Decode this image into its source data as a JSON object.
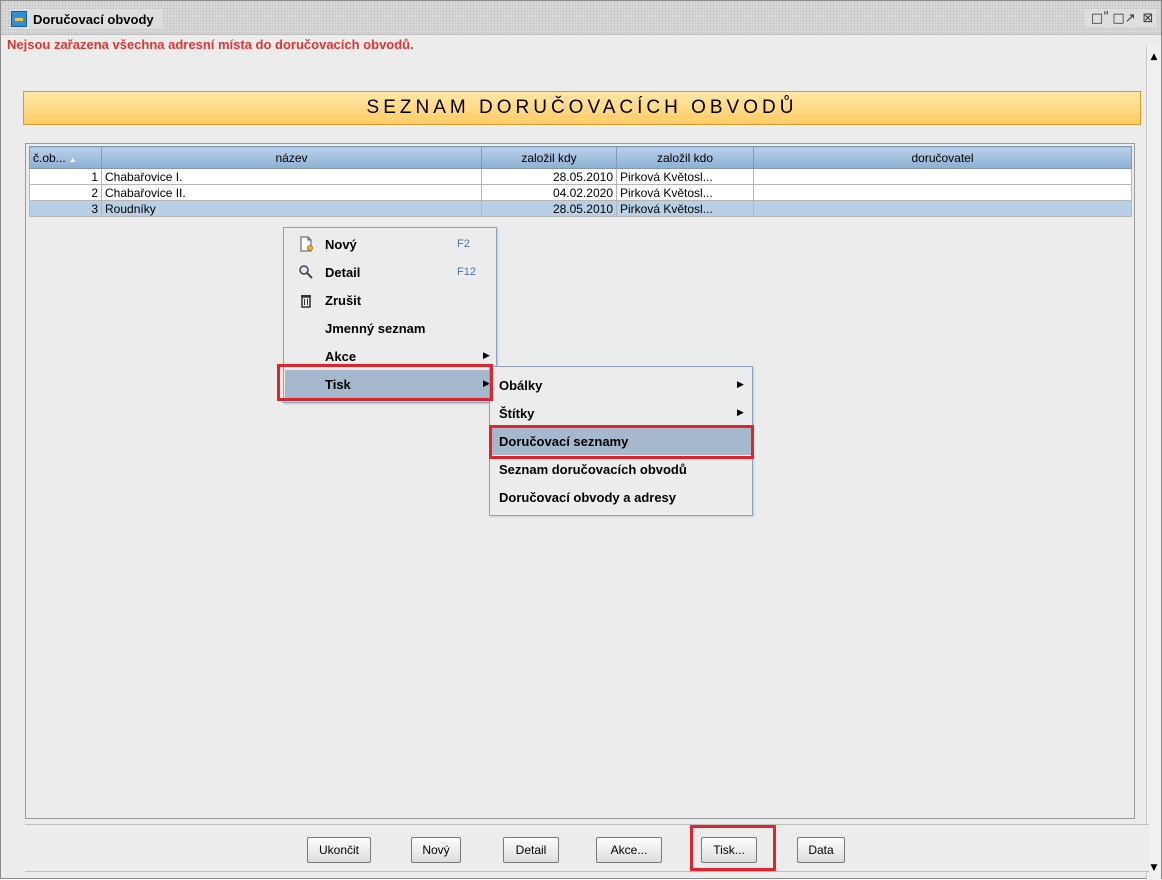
{
  "window": {
    "title": "Doručovací obvody",
    "controls": {
      "minimize_icon": "□ʺ",
      "maximize_icon": "□↗",
      "close_icon": "⊠"
    }
  },
  "warning": "Nejsou zařazena všechna adresní místa do doručovacích obvodů.",
  "banner": "SEZNAM DORUČOVACÍCH OBVODŮ",
  "table": {
    "columns": [
      "č.ob...",
      "název",
      "založil kdy",
      "založil kdo",
      "doručovatel"
    ],
    "rows": [
      {
        "cislo": "1",
        "nazev": "Chabařovice I.",
        "kdy": "28.05.2010",
        "kdo": "Pirková Květosl...",
        "dorucovatel": ""
      },
      {
        "cislo": "2",
        "nazev": "Chabařovice II.",
        "kdy": "04.02.2020",
        "kdo": "Pirková Květosl...",
        "dorucovatel": ""
      },
      {
        "cislo": "3",
        "nazev": "Roudníky",
        "kdy": "28.05.2010",
        "kdo": "Pirková Květosl...",
        "dorucovatel": ""
      }
    ]
  },
  "context_menu": {
    "items": [
      {
        "label": "Nový",
        "accel": "F2",
        "icon": "new-document-icon"
      },
      {
        "label": "Detail",
        "accel": "F12",
        "icon": "magnifier-icon"
      },
      {
        "label": "Zrušit",
        "accel": "",
        "icon": "trash-icon"
      },
      {
        "label": "Jmenný seznam",
        "accel": "",
        "icon": ""
      },
      {
        "label": "Akce",
        "accel": "",
        "icon": ""
      },
      {
        "label": "Tisk",
        "accel": "",
        "icon": ""
      }
    ]
  },
  "submenu": {
    "items": [
      "Obálky",
      "Štítky",
      "Doručovací seznamy",
      "Seznam doručovacích obvodů",
      "Doručovací obvody a adresy"
    ]
  },
  "buttons": [
    "Ukončit",
    "Nový",
    "Detail",
    "Akce...",
    "Tisk...",
    "Data"
  ],
  "colors": {
    "warning": "#e3342f",
    "highlight": "#e0242b",
    "banner": "#ffcc66",
    "selected_row": "#b8cfe5"
  }
}
